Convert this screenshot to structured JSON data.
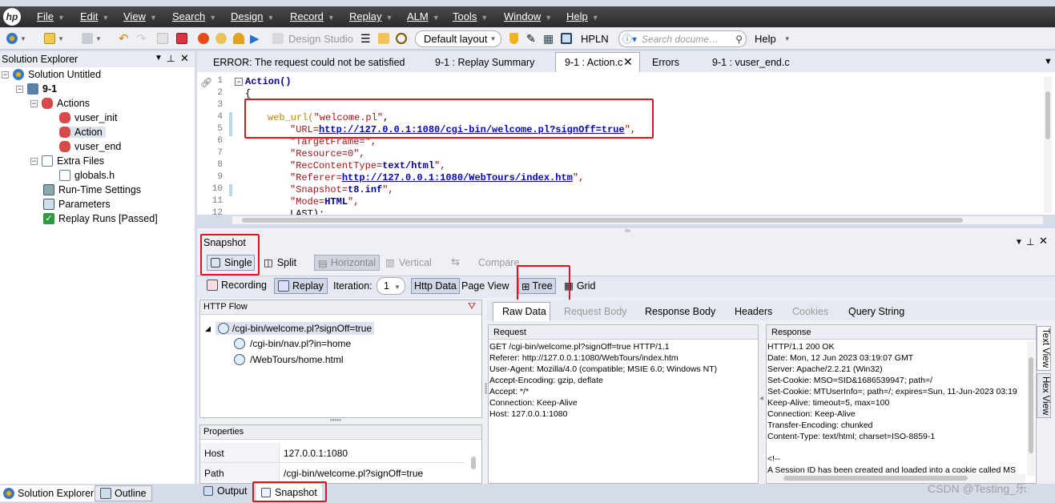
{
  "menubar": {
    "logo": "hp",
    "items": [
      "File",
      "Edit",
      "View",
      "Search",
      "Design",
      "Record",
      "Replay",
      "ALM",
      "Tools",
      "Window",
      "Help"
    ]
  },
  "toolbar": {
    "design_studio": "Design Studio",
    "layout": "Default layout",
    "hpln": "HPLN",
    "search_placeholder": "Search docume…",
    "help": "Help"
  },
  "solution_explorer": {
    "title": "Solution Explorer",
    "solution": "Solution Untitled",
    "script": "9-1",
    "actions": "Actions",
    "vuser_init": "vuser_init",
    "action": "Action",
    "vuser_end": "vuser_end",
    "extra_files": "Extra Files",
    "globals": "globals.h",
    "runtime": "Run-Time Settings",
    "parameters": "Parameters",
    "replay_runs": "Replay Runs [Passed]"
  },
  "bottom_left_tabs": [
    "Solution Explorer",
    "Outline"
  ],
  "editor": {
    "tabs": [
      "ERROR: The request could not be satisfied",
      "9-1 : Replay Summary",
      "9-1 : Action.c",
      "Errors",
      "9-1 : vuser_end.c"
    ],
    "line_numbers": [
      "1",
      "2",
      "3",
      "4",
      "5",
      "6",
      "7",
      "8",
      "9",
      "10",
      "11",
      "12"
    ],
    "code": {
      "l1": "Action()",
      "l2": "{",
      "l4_fn": "web_url(",
      "l4_str": "\"welcome.pl\"",
      "l4_end": ",",
      "l5_a": "\"URL=",
      "l5_url": "http://127.0.0.1:1080/cgi-bin/welcome.pl?signOff=true",
      "l5_b": "\",",
      "l6": "\"TargetFrame=\",",
      "l7": "\"Resource=0\",",
      "l8_a": "\"RecContentType=",
      "l8_b": "text/html",
      "l8_c": "\",",
      "l9_a": "\"Referer=",
      "l9_url": "http://127.0.0.1:1080/WebTours/index.htm",
      "l9_b": "\",",
      "l10_a": "\"Snapshot=",
      "l10_b": "t8.inf",
      "l10_c": "\",",
      "l11_a": "\"Mode=",
      "l11_b": "HTML",
      "l11_c": "\",",
      "l12": "LAST);"
    }
  },
  "snapshot": {
    "title": "Snapshot",
    "single": "Single",
    "split": "Split",
    "horizontal": "Horizontal",
    "vertical": "Vertical",
    "compare": "Compare",
    "recording": "Recording",
    "replay": "Replay",
    "iteration_label": "Iteration:",
    "iteration_value": "1",
    "http_data": "Http Data",
    "page_view": "Page View",
    "tree": "Tree",
    "grid": "Grid",
    "http_flow_title": "HTTP Flow",
    "flow": [
      "/cgi-bin/welcome.pl?signOff=true",
      "/cgi-bin/nav.pl?in=home",
      "/WebTours/home.html"
    ],
    "properties_title": "Properties",
    "properties": [
      {
        "key": "Host",
        "value": "127.0.0.1:1080"
      },
      {
        "key": "Path",
        "value": "/cgi-bin/welcome.pl?signOff=true"
      }
    ],
    "data_tabs": [
      "Raw Data",
      "Request Body",
      "Response Body",
      "Headers",
      "Cookies",
      "Query String"
    ],
    "request_title": "Request",
    "request_lines": [
      "GET /cgi-bin/welcome.pl?signOff=true HTTP/1.1",
      "Referer: http://127.0.0.1:1080/WebTours/index.htm",
      "User-Agent: Mozilla/4.0 (compatible; MSIE 6.0; Windows NT)",
      "Accept-Encoding: gzip, deflate",
      "Accept: */*",
      "Connection: Keep-Alive",
      "Host: 127.0.0.1:1080"
    ],
    "response_title": "Response",
    "response_lines": [
      "HTTP/1.1 200 OK",
      "Date: Mon, 12 Jun 2023 03:19:07 GMT",
      "Server: Apache/2.2.21 (Win32)",
      "Set-Cookie: MSO=SID&1686539947; path=/",
      "Set-Cookie: MTUserInfo=; path=/; expires=Sun, 11-Jun-2023 03:19",
      "Keep-Alive: timeout=5, max=100",
      "Connection: Keep-Alive",
      "Transfer-Encoding: chunked",
      "Content-Type: text/html; charset=ISO-8859-1",
      "",
      "<!--",
      "A Session ID has been created and loaded into a cookie called MS"
    ],
    "side_tabs": [
      "Text View",
      "Hex View"
    ]
  },
  "bottom_tabs": [
    "Output",
    "Snapshot"
  ],
  "watermark": "CSDN @Testing_乐"
}
